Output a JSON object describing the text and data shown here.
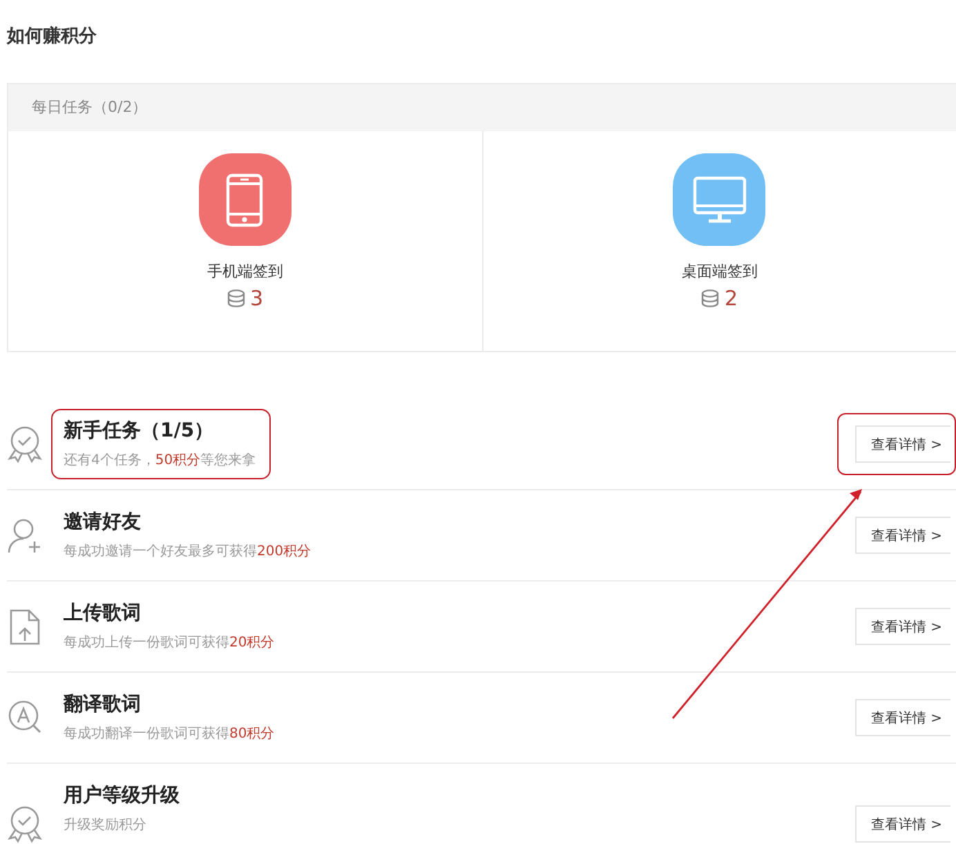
{
  "page_title": "如何赚积分",
  "daily": {
    "heading": "每日任务（0/2）",
    "items": [
      {
        "kind": "phone",
        "label": "手机端签到",
        "points": "3",
        "color": "#f07070"
      },
      {
        "kind": "desktop",
        "label": "桌面端签到",
        "points": "2",
        "color": "#72bff5"
      }
    ]
  },
  "tasks": [
    {
      "kind": "badge",
      "title": "新手任务（1/5）",
      "subtitle": [
        {
          "text": "还有4个任务，",
          "highlight": false
        },
        {
          "text": "50积分",
          "highlight": true
        },
        {
          "text": "等您来拿",
          "highlight": false
        }
      ],
      "button": "查看详情 >",
      "annotated": true
    },
    {
      "kind": "user",
      "title": "邀请好友",
      "subtitle": [
        {
          "text": "每成功邀请一个好友最多可获得",
          "highlight": false
        },
        {
          "text": "200积分",
          "highlight": true
        }
      ],
      "button": "查看详情 >",
      "annotated": false
    },
    {
      "kind": "upload",
      "title": "上传歌词",
      "subtitle": [
        {
          "text": "每成功上传一份歌词可获得",
          "highlight": false
        },
        {
          "text": "20积分",
          "highlight": true
        }
      ],
      "button": "查看详情 >",
      "annotated": false
    },
    {
      "kind": "translate",
      "title": "翻译歌词",
      "subtitle": [
        {
          "text": "每成功翻译一份歌词可获得",
          "highlight": false
        },
        {
          "text": "80积分",
          "highlight": true
        }
      ],
      "button": "查看详情 >",
      "annotated": false
    },
    {
      "kind": "badge",
      "title": "用户等级升级",
      "subtitle": [
        {
          "text": "升级奖励积分",
          "highlight": false
        }
      ],
      "button": "查看详情 >",
      "annotated": false
    }
  ]
}
